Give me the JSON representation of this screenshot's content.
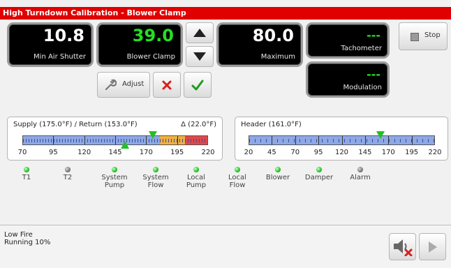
{
  "title": "High Turndown Calibration - Blower Clamp",
  "panels": {
    "min_air_shutter": {
      "value": "10.8",
      "label": "Min Air Shutter"
    },
    "blower_clamp": {
      "value": "39.0",
      "label": "Blower Clamp"
    },
    "maximum": {
      "value": "80.0",
      "label": "Maximum"
    },
    "tachometer": {
      "value": "---",
      "label": "Tachometer"
    },
    "modulation": {
      "value": "---",
      "label": "Modulation"
    }
  },
  "buttons": {
    "stop_label": "Stop",
    "adjust_label": "Adjust"
  },
  "supply_gauge": {
    "label_left": "Supply (175.0°F) / Return (153.0°F)",
    "label_right": "Δ (22.0°F)",
    "scale": [
      "70",
      "95",
      "120",
      "145",
      "170",
      "195",
      "220"
    ]
  },
  "header_gauge": {
    "label": "Header (161.0°F)",
    "scale": [
      "20",
      "45",
      "70",
      "95",
      "120",
      "145",
      "170",
      "195",
      "220"
    ]
  },
  "indicators": [
    {
      "label": "T1",
      "state": "on"
    },
    {
      "label": "T2",
      "state": "off"
    },
    {
      "label": "System Pump",
      "state": "on"
    },
    {
      "label": "System Flow",
      "state": "on"
    },
    {
      "label": "Local Pump",
      "state": "on"
    },
    {
      "label": "Local Flow",
      "state": "on"
    },
    {
      "label": "Blower",
      "state": "on"
    },
    {
      "label": "Damper",
      "state": "on"
    },
    {
      "label": "Alarm",
      "state": "off"
    }
  ],
  "status": {
    "line1": "Low Fire",
    "line2": "Running 10%"
  },
  "colors": {
    "title_bar": "#e00000",
    "value_green": "#22e022",
    "bar_blue": "#8ea8e6",
    "bar_orange": "#f0b040",
    "bar_red": "#e04848"
  }
}
